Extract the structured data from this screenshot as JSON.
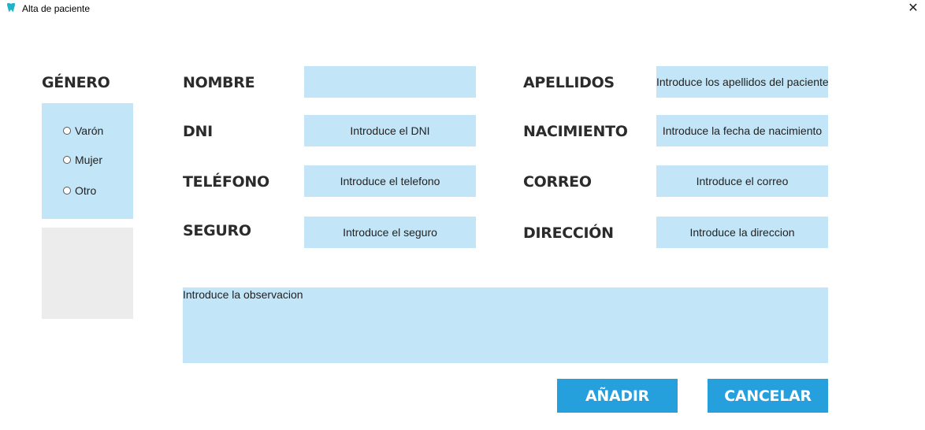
{
  "window": {
    "title": "Alta de paciente",
    "icon": "tooth-icon",
    "close_label": "✕"
  },
  "gender": {
    "heading": "GÉNERO",
    "options": [
      "Varón",
      "Mujer",
      "Otro"
    ]
  },
  "form": {
    "nombre": {
      "label": "NOMBRE",
      "value": "",
      "placeholder": ""
    },
    "apellidos": {
      "label": "APELLIDOS",
      "value": "Introduce los apellidos del paciente"
    },
    "dni": {
      "label": "DNI",
      "value": "Introduce el DNI"
    },
    "nacimiento": {
      "label": "NACIMIENTO",
      "value": "Introduce la fecha de nacimiento"
    },
    "telefono": {
      "label": "TELÉFONO",
      "value": "Introduce el telefono"
    },
    "correo": {
      "label": "CORREO",
      "value": "Introduce el correo"
    },
    "seguro": {
      "label": "SEGURO",
      "value": "Introduce el seguro"
    },
    "direccion": {
      "label": "DIRECCIÓN",
      "value": "Introduce la direccion"
    },
    "observacion": {
      "value": "Introduce la observacion"
    }
  },
  "buttons": {
    "add_label": "AÑADIR",
    "cancel_label": "CANCELAR"
  },
  "colors": {
    "field_bg": "#c2e6f8",
    "button_bg": "#25a0dc",
    "photo_bg": "#ececec"
  }
}
